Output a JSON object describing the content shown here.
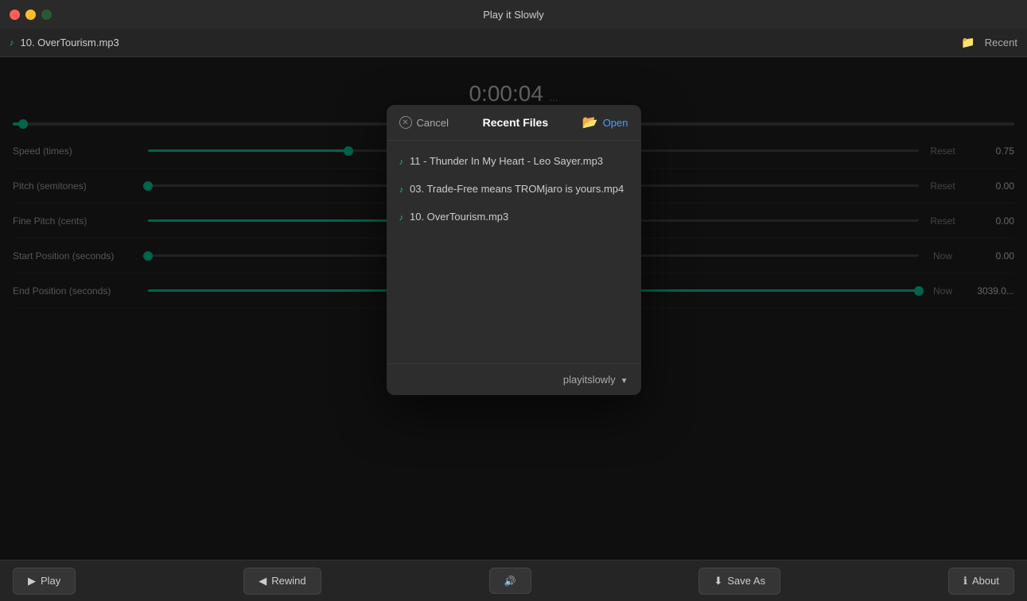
{
  "window": {
    "title": "Play it Slowly"
  },
  "file_bar": {
    "current_file": "10. OverTourism.mp3",
    "recent_label": "Recent"
  },
  "time_display": {
    "time": "0:00:04",
    "sub": "..."
  },
  "seek_bar": {
    "position_percent": 1
  },
  "controls": [
    {
      "id": "speed",
      "label": "Speed (times)",
      "fill_percent": 26,
      "handle_percent": 26,
      "reset_label": "Reset",
      "value": "0.75"
    },
    {
      "id": "pitch",
      "label": "Pitch (semitones)",
      "fill_percent": 0,
      "handle_percent": 0,
      "reset_label": "Reset",
      "value": "0.00"
    },
    {
      "id": "fine_pitch",
      "label": "Fine Pitch (cents)",
      "fill_percent": 50,
      "handle_percent": 50,
      "reset_label": "Reset",
      "value": "0.00"
    },
    {
      "id": "start_position",
      "label": "Start Position (seconds)",
      "fill_percent": 0,
      "handle_percent": 0,
      "reset_label": "Now",
      "value": "0.00"
    },
    {
      "id": "end_position",
      "label": "End Position (seconds)",
      "fill_percent": 100,
      "handle_percent": 100,
      "reset_label": "Now",
      "value": "3039.0..."
    }
  ],
  "bottom_toolbar": {
    "play_label": "Play",
    "rewind_label": "Rewind",
    "volume_label": "",
    "save_as_label": "Save As",
    "about_label": "About"
  },
  "modal": {
    "cancel_label": "Cancel",
    "title": "Recent Files",
    "open_label": "Open",
    "files": [
      {
        "name": "11 - Thunder In My Heart - Leo Sayer.mp3"
      },
      {
        "name": "03. Trade-Free means TROMjaro is yours.mp4"
      },
      {
        "name": "10. OverTourism.mp3"
      }
    ],
    "footer_label": "playitslowly"
  }
}
